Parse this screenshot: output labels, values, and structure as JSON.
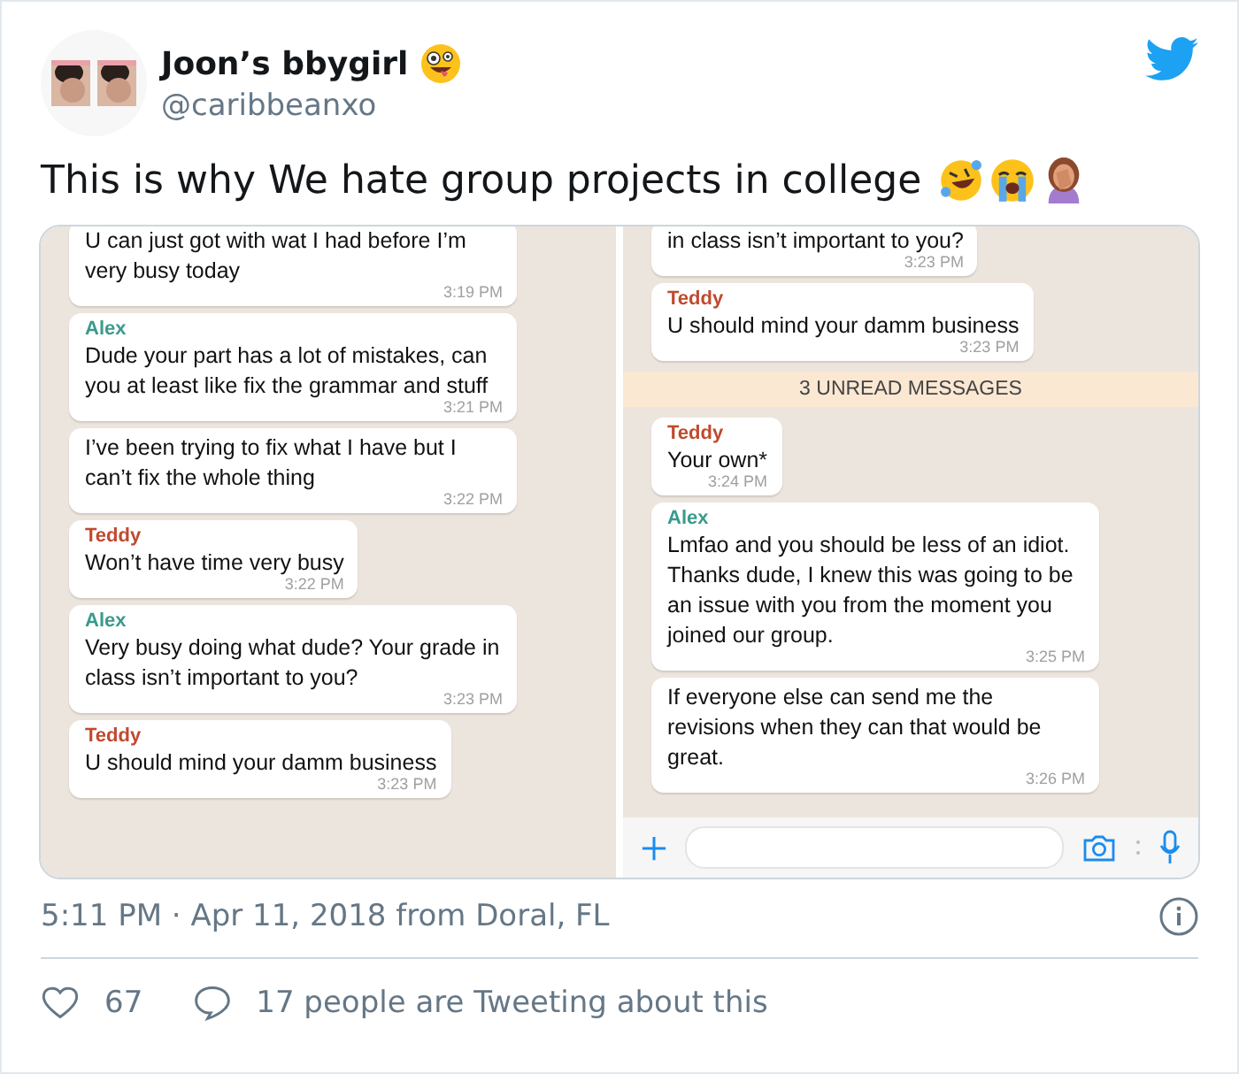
{
  "author": {
    "name": "Joon’s bbygirl",
    "handle": "@caribbeanxo"
  },
  "text": "This is why We hate group projects in college",
  "panels": [
    {
      "composer": false,
      "items": [
        {
          "kind": "message",
          "text": "U can just got with wat I had before I’m very busy today",
          "time": "3:19 PM"
        },
        {
          "kind": "message",
          "sender": "Alex",
          "color": "#3a9a8c",
          "text": "Dude your part has a lot of mistakes, can you at least like fix the grammar and stuff",
          "time": "3:21 PM"
        },
        {
          "kind": "message",
          "text": "I’ve been trying to fix what I have but I can’t fix the whole thing",
          "time": "3:22 PM"
        },
        {
          "kind": "message",
          "sender": "Teddy",
          "color": "#c04a2e",
          "text": "Won’t have time very busy",
          "time": "3:22 PM"
        },
        {
          "kind": "message",
          "sender": "Alex",
          "color": "#3a9a8c",
          "text": "Very busy doing what dude? Your grade in class isn’t important to you?",
          "time": "3:23 PM"
        },
        {
          "kind": "message",
          "sender": "Teddy",
          "color": "#c04a2e",
          "text": "U should mind your damm business",
          "time": "3:23 PM"
        }
      ]
    },
    {
      "composer": true,
      "items": [
        {
          "kind": "message",
          "text": "in class isn’t important to you?",
          "time": "3:23 PM"
        },
        {
          "kind": "message",
          "sender": "Teddy",
          "color": "#c04a2e",
          "text": "U should mind your damm business",
          "time": "3:23 PM"
        },
        {
          "kind": "divider",
          "text": "3 UNREAD MESSAGES"
        },
        {
          "kind": "message",
          "sender": "Teddy",
          "color": "#c04a2e",
          "text": "Your own*",
          "time": "3:24 PM"
        },
        {
          "kind": "message",
          "sender": "Alex",
          "color": "#3a9a8c",
          "text": "Lmfao and you should be less of an idiot. Thanks dude, I knew this was going to be an issue with you from the moment you joined our group.",
          "time": "3:25 PM"
        },
        {
          "kind": "message",
          "text": "If everyone else can send me the revisions when they can that would be great.",
          "time": "3:26 PM"
        }
      ]
    }
  ],
  "timestamp": "5:11 PM · Apr 11, 2018 from Doral, FL",
  "likes": "67",
  "replies": "17 people are Tweeting about this"
}
